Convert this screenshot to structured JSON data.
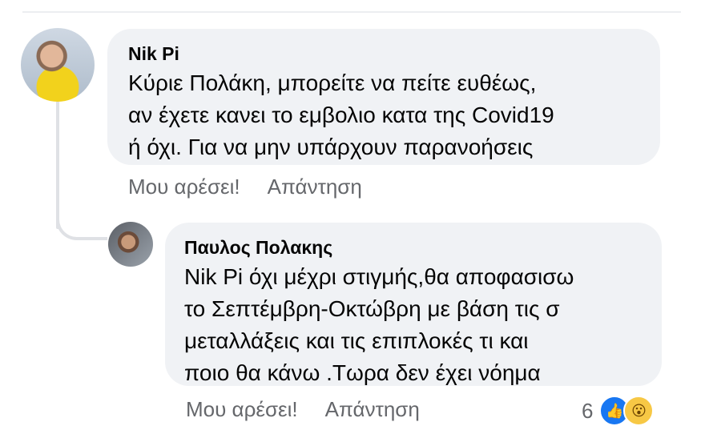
{
  "comments": [
    {
      "author": "Nik Pi",
      "text": "Κύριε Πολάκη, μπορείτε να πείτε ευθέως,\nαν έχετε κανει το εμβολιο κατα της Covid19\nή όχι. Για να μην υπάρχουν παρανοήσεις",
      "like_label": "Μου αρέσει!",
      "reply_label": "Απάντηση"
    }
  ],
  "reply": {
    "author": "Παυλος Πολακης",
    "text": "Nik Pi όχι μέχρι στιγμής,θα αποφασισω\nτο Σεπτέμβρη-Οκτώβρη με βάση τις σ\nμεταλλάξεις και τις επιπλοκές τι και\nποιο θα κάνω .Τωρα δεν έχει νόημα",
    "like_label": "Μου αρέσει!",
    "reply_label": "Απάντηση",
    "reaction_count": "6",
    "reaction_icons": [
      "like-icon",
      "wow-icon"
    ]
  },
  "colors": {
    "bubble": "#f0f2f5",
    "meta_text": "#65676b",
    "like_blue": "#1877f2",
    "wow_yellow": "#f7c845"
  }
}
